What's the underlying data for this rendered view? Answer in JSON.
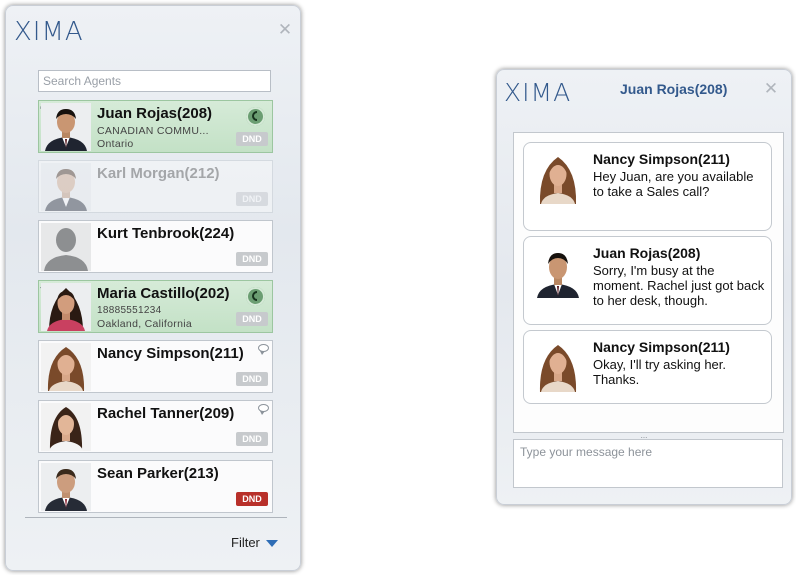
{
  "colors": {
    "brand": "#33598c",
    "available_green": "#c3e1c6",
    "dnd_on": "#b8302a",
    "dnd_off": "#c7cacd",
    "filter_arrow": "#2e6db6"
  },
  "agents_panel": {
    "logo": "XIMA",
    "search": {
      "placeholder": "Search Agents",
      "value": ""
    },
    "agents": [
      {
        "name": "Juan Rojas(208)",
        "line1": "CANADIAN COMMU...",
        "line2": "Ontario",
        "status": "on-call",
        "dnd": "DND",
        "icons": [
          "outgoing-arrow-icon",
          "phone-icon"
        ]
      },
      {
        "name": "Karl Morgan(212)",
        "line1": "",
        "line2": "",
        "status": "offline",
        "dnd": "DND"
      },
      {
        "name": "Kurt Tenbrook(224)",
        "line1": "",
        "line2": "",
        "status": "available",
        "dnd": "DND"
      },
      {
        "name": "Maria Castillo(202)",
        "line1": "18885551234",
        "line2": "Oakland, California",
        "status": "on-call",
        "dnd": "DND",
        "icons": [
          "incoming-arrow-icon",
          "phone-icon"
        ]
      },
      {
        "name": "Nancy Simpson(211)",
        "line1": "",
        "line2": "",
        "status": "available",
        "dnd": "DND",
        "icons": [
          "chat-icon"
        ]
      },
      {
        "name": "Rachel Tanner(209)",
        "line1": "",
        "line2": "",
        "status": "available",
        "dnd": "DND",
        "icons": [
          "chat-icon"
        ]
      },
      {
        "name": "Sean Parker(213)",
        "line1": "",
        "line2": "",
        "status": "dnd",
        "dnd": "DND"
      }
    ],
    "filter_label": "Filter"
  },
  "chat_panel": {
    "logo": "XIMA",
    "title": "Juan Rojas(208)",
    "messages": [
      {
        "sender": "Nancy Simpson(211)",
        "text": "Hey Juan, are you available to take a Sales call?"
      },
      {
        "sender": "Juan Rojas(208)",
        "text": "Sorry, I'm busy at the moment. Rachel just got back to her desk, though."
      },
      {
        "sender": "Nancy Simpson(211)",
        "text": "Okay, I'll try asking her. Thanks."
      }
    ],
    "grip": "...",
    "input_placeholder": "Type your message here"
  }
}
